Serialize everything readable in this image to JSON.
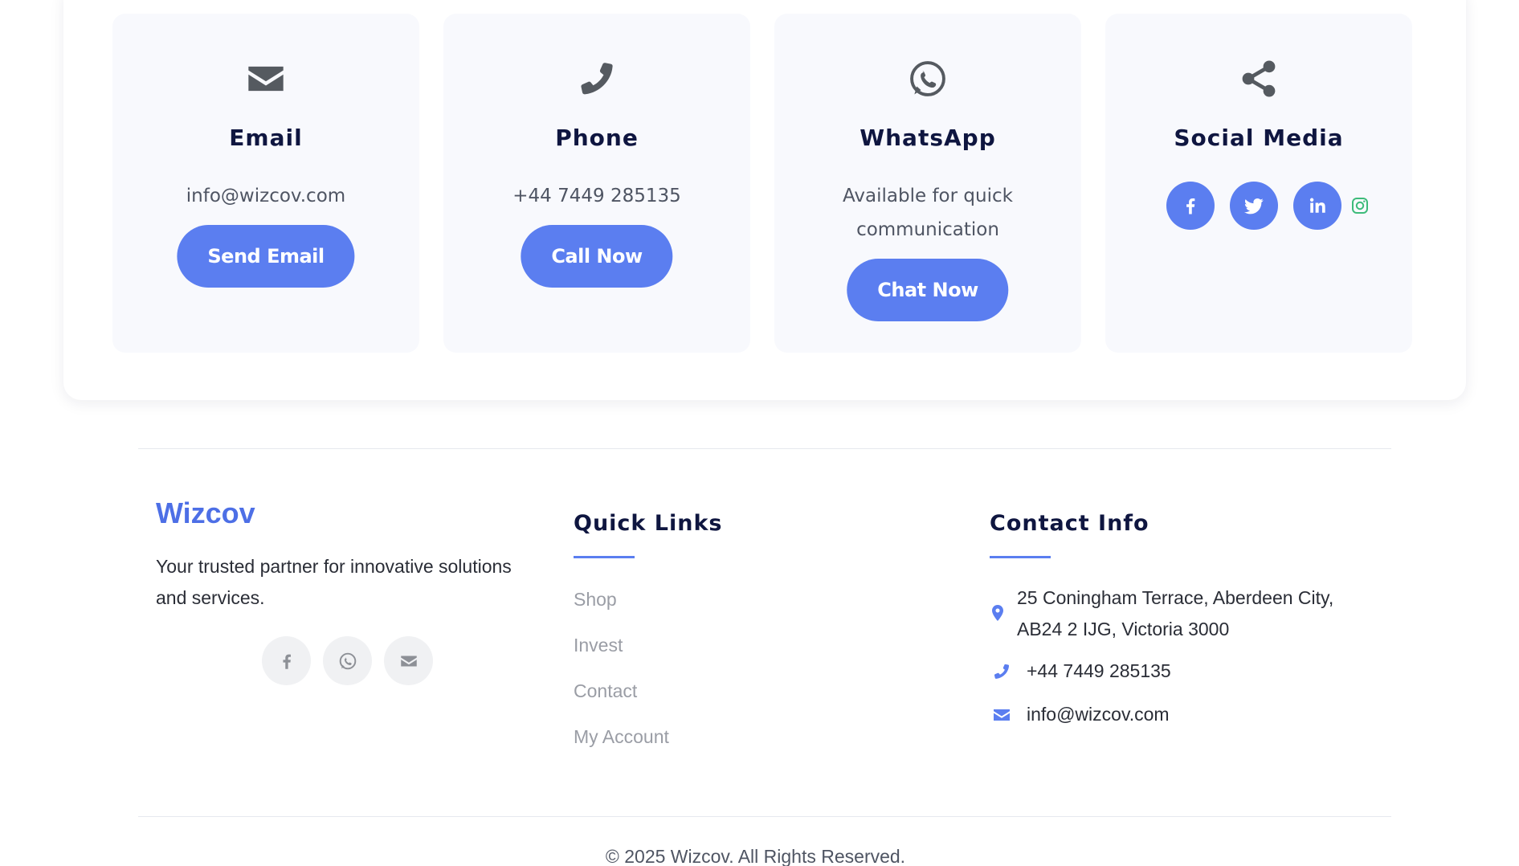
{
  "contact_cards": {
    "email": {
      "title": "Email",
      "text": "info@wizcov.com",
      "button": "Send Email"
    },
    "phone": {
      "title": "Phone",
      "text": "+44 7449 285135",
      "button": "Call Now"
    },
    "whatsapp": {
      "title": "WhatsApp",
      "text": "Available for quick communication",
      "button": "Chat Now"
    },
    "social": {
      "title": "Social Media",
      "icons": [
        "facebook-icon",
        "twitter-icon",
        "linkedin-icon",
        "instagram-icon"
      ]
    }
  },
  "footer": {
    "brand": "Wizcov",
    "tagline": "Your trusted partner for innovative solutions and services.",
    "social_icons": [
      "facebook-icon",
      "whatsapp-icon",
      "envelope-icon"
    ],
    "quick_links": {
      "title": "Quick Links",
      "items": [
        "Shop",
        "Invest",
        "Contact",
        "My Account"
      ]
    },
    "contact_info": {
      "title": "Contact Info",
      "address": "25 Coningham Terrace, Aberdeen City, AB24 2 IJG, Victoria 3000",
      "phone": "+44 7449 285135",
      "email": "info@wizcov.com"
    },
    "copyright": "© 2025 Wizcov. All Rights Reserved."
  },
  "colors": {
    "accent": "#5b7ef0",
    "brand": "#4d6fe6",
    "heading": "#0f1640",
    "instagram": "#3dbb7a"
  }
}
